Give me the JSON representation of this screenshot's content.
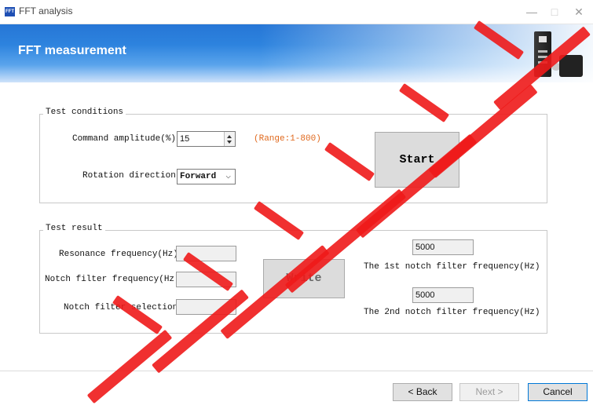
{
  "window": {
    "title": "FFT analysis",
    "icon_text": "FFT",
    "minimize_glyph": "—",
    "maximize_glyph": "□",
    "close_glyph": "✕"
  },
  "header": {
    "title": "FFT measurement"
  },
  "test_conditions": {
    "group_title": "Test conditions",
    "amplitude_label": "Command amplitude(%)",
    "amplitude_value": "15",
    "range_text": "(Range:1-800)",
    "direction_label": "Rotation direction",
    "direction_value": "Forward",
    "start_label": "Start"
  },
  "test_result": {
    "group_title": "Test result",
    "resonance_label": "Resonance frequency(Hz)",
    "resonance_value": "",
    "notch_freq_label": "Notch filter frequency(Hz)",
    "notch_freq_value": "",
    "notch_sel_label": "Notch filter selection",
    "notch_sel_value": "",
    "write_label": "Write",
    "notch1_value": "5000",
    "notch1_label": "The 1st notch filter frequency(Hz)",
    "notch2_value": "5000",
    "notch2_label": "The 2nd notch filter frequency(Hz)"
  },
  "footer": {
    "back_label": "< Back",
    "next_label": "Next >",
    "cancel_label": "Cancel"
  },
  "colors": {
    "banner_blue": "#2676d6",
    "range_orange": "#e0681c",
    "watermark_red": "#ee1a1a"
  }
}
